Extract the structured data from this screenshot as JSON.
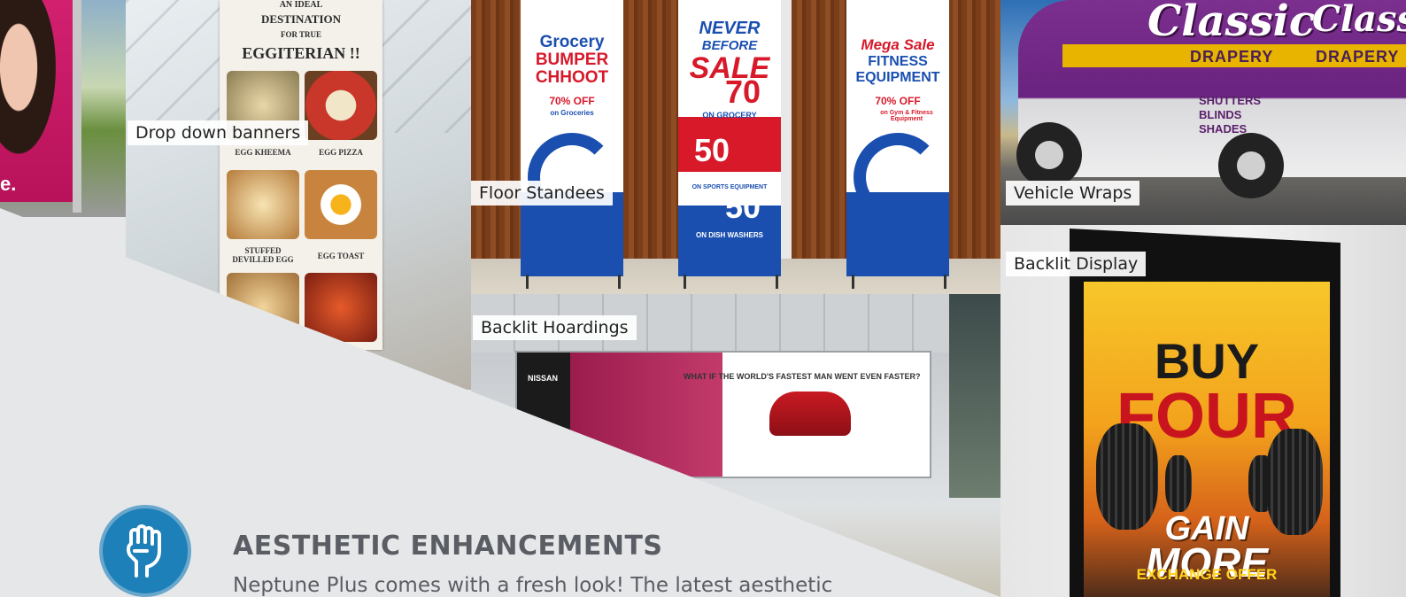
{
  "labels": {
    "dropdown": "Drop down banners",
    "standees": "Floor Standees",
    "vehicle": "Vehicle Wraps",
    "display": "Backlit Display",
    "hoardings": "Backlit Hoardings"
  },
  "left_edge": {
    "text": "e."
  },
  "dropdown_banner": {
    "line1": "AN IDEAL",
    "line2": "DESTINATION",
    "line3": "FOR TRUE",
    "line4": "EGGITERIAN !!",
    "items": [
      "EGG KHEEMA",
      "EGG PIZZA",
      "STUFFED DEVILLED EGG",
      "EGG TOAST"
    ]
  },
  "standees": [
    {
      "title1": "Grocery",
      "title2": "BUMPER",
      "title3": "CHHOOT",
      "offer": "70% OFF",
      "sub": "on Groceries"
    },
    {
      "title1": "NEVER",
      "title2": "BEFORE",
      "title3": "SALE",
      "deal1": "70",
      "deal1_label": "ON GROCERY",
      "deal2": "50",
      "deal2_label": "ON SPORTS EQUIPMENT",
      "deal3": "50",
      "deal3_label": "ON DISH WASHERS"
    },
    {
      "title1": "Mega Sale",
      "title2": "FITNESS",
      "title3": "EQUIPMENT",
      "offer": "70% OFF",
      "sub": "on Gym & Fitness Equipment"
    }
  ],
  "van": {
    "brand": "Classic",
    "brand_sub": "DRAPERY",
    "services": [
      "SHUTTERS",
      "BLINDS",
      "SHADES"
    ]
  },
  "display_ad": {
    "line1": "BUY",
    "line2": "FOUR",
    "line3": "GAIN",
    "line4": "MORE",
    "offer": "EXCHANGE OFFER"
  },
  "hoarding": {
    "headline": "WHAT IF THE WORLD'S FASTEST MAN WENT EVEN FASTER?",
    "brand": "NISSAN"
  },
  "feature": {
    "title": "AESTHETIC ENHANCEMENTS",
    "text": "Neptune Plus comes with a fresh look! The latest aesthetic"
  },
  "colors": {
    "accent_blue": "#1d80b8",
    "standee_blue": "#1a4fb0",
    "standee_red": "#d7192a",
    "van_purple": "#6a2380",
    "text_gray": "#5a5d63"
  }
}
